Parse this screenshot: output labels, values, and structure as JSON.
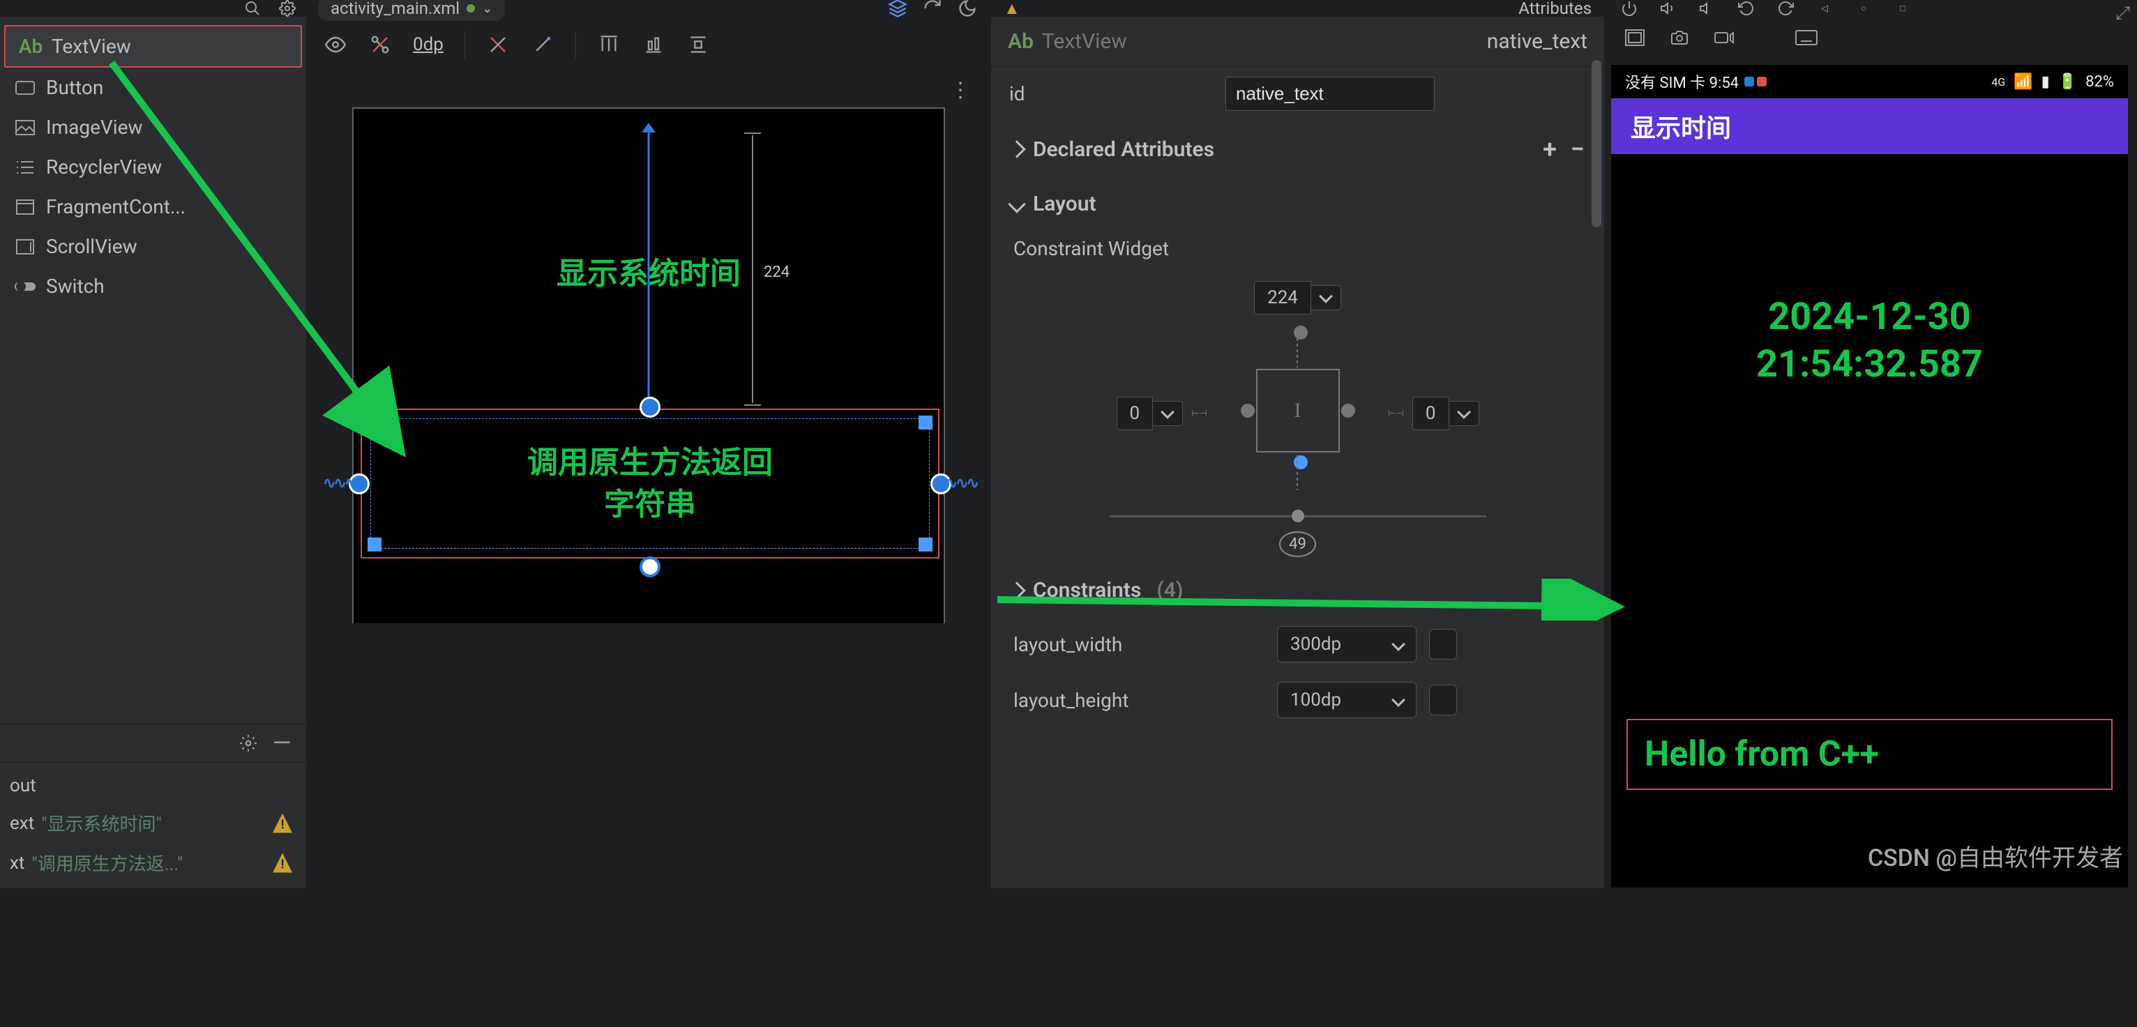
{
  "file_tab": {
    "name": "activity_main.xml"
  },
  "palette": {
    "items": [
      {
        "label": "TextView",
        "selected": true
      },
      {
        "label": "Button"
      },
      {
        "label": "ImageView"
      },
      {
        "label": "RecyclerView"
      },
      {
        "label": "FragmentCont..."
      },
      {
        "label": "ScrollView"
      },
      {
        "label": "Switch"
      }
    ]
  },
  "component_tree": {
    "root_label": "out",
    "rows": [
      {
        "label": "ext",
        "value": "\"显示系统时间\"",
        "warn": true
      },
      {
        "label": "xt",
        "value": "\"调用原生方法返...\"",
        "warn": true
      }
    ]
  },
  "design_toolbar": {
    "zero_dp": "0dp"
  },
  "canvas": {
    "time_text": "显示系统时间",
    "native_text_line1": "调用原生方法返回",
    "native_text_line2": "字符串",
    "top_margin_value": "224"
  },
  "attributes": {
    "panel_title": "Attributes",
    "type_label": "TextView",
    "instance_name": "native_text",
    "id_label": "id",
    "id_value": "native_text",
    "declared_heading": "Declared Attributes",
    "layout_heading": "Layout",
    "constraint_widget_label": "Constraint Widget",
    "top_value": "224",
    "left_value": "0",
    "right_value": "0",
    "bias_value": "49",
    "constraints_heading": "Constraints",
    "constraints_count": "(4)",
    "width_label": "layout_width",
    "width_value": "300dp",
    "height_label": "layout_height",
    "height_value": "100dp"
  },
  "emulator": {
    "status": {
      "sim_text": "没有 SIM 卡 9:54",
      "net": "4G",
      "battery": "82%"
    },
    "appbar_title": "显示时间",
    "clock_line1": "2024-12-30",
    "clock_line2": "21:54:32.587",
    "native_out": "Hello from C++"
  },
  "watermark": "CSDN @自由软件开发者"
}
